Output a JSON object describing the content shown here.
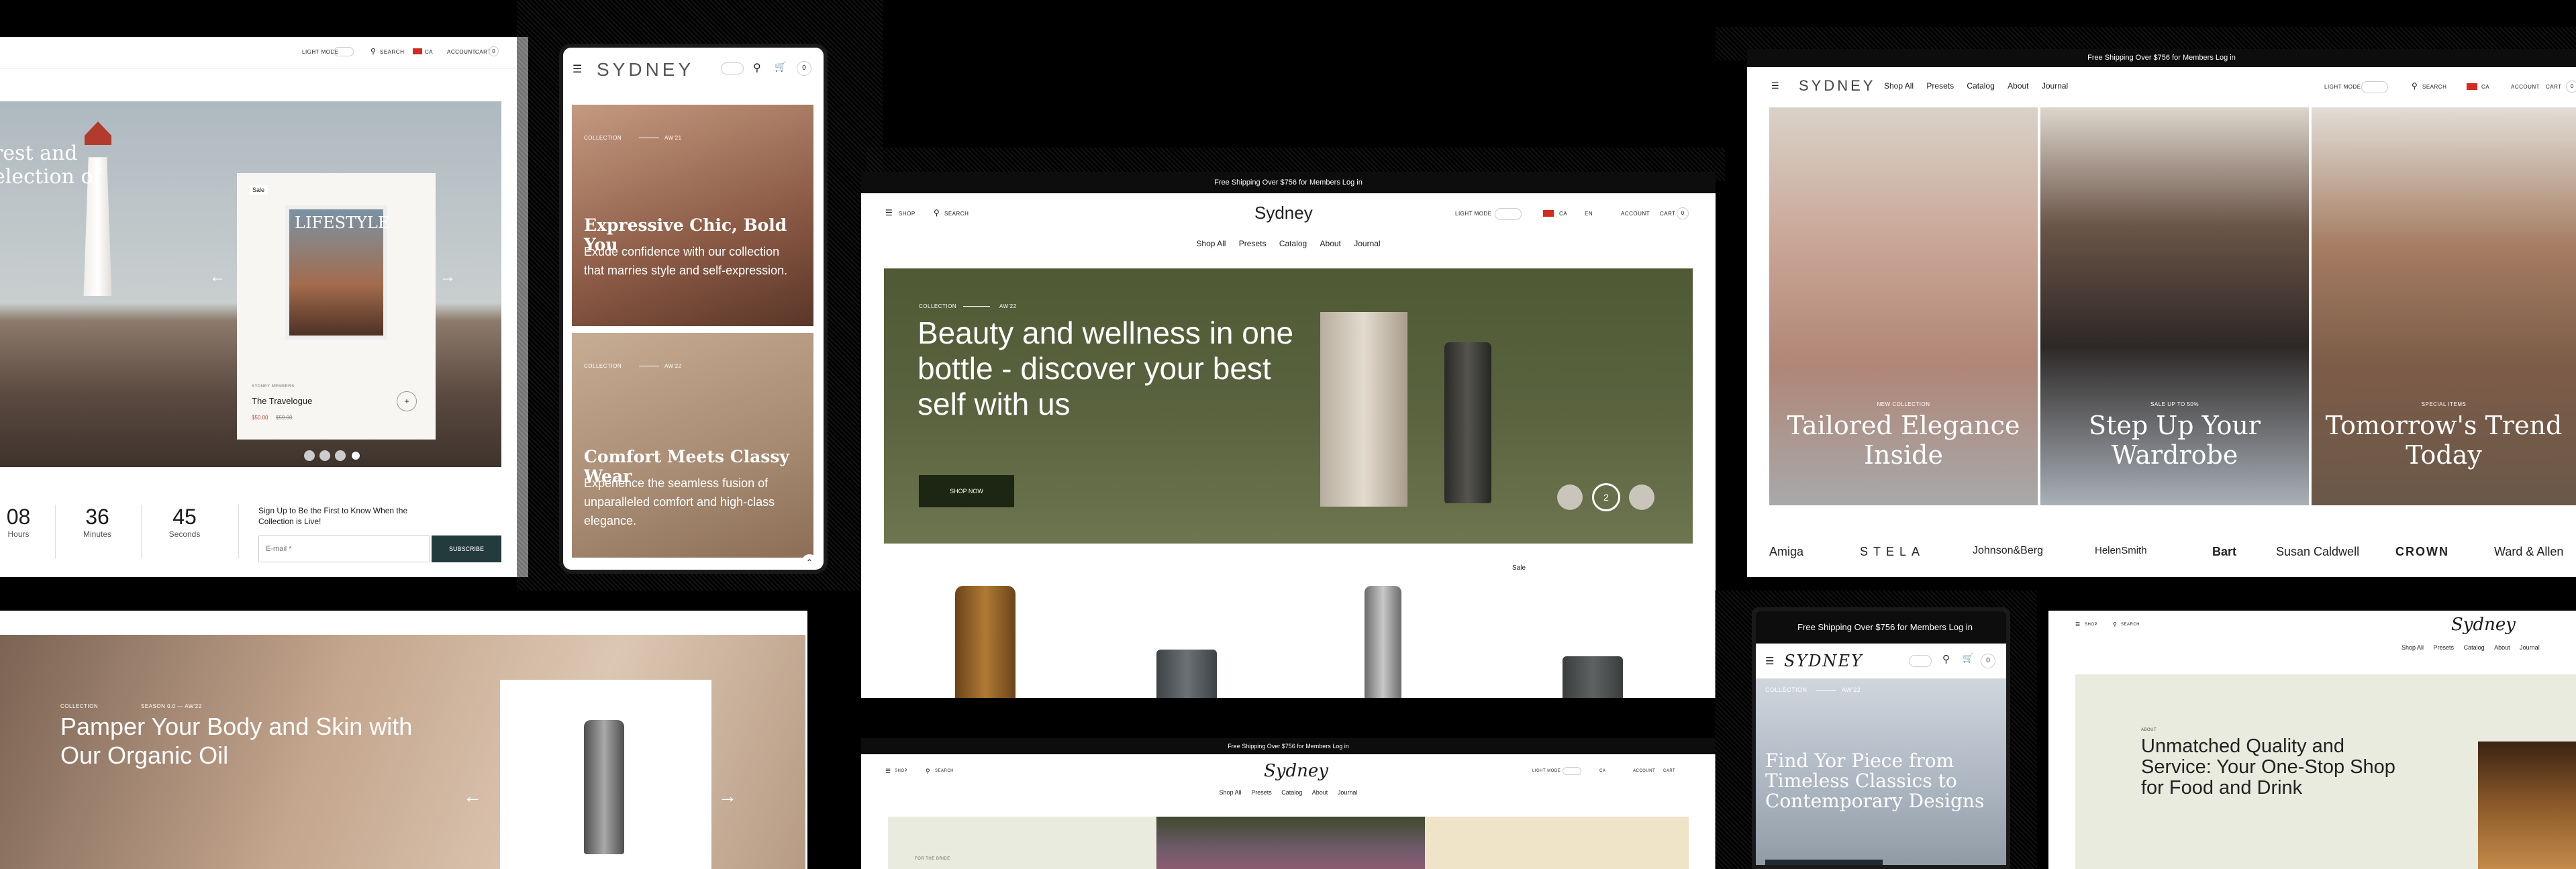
{
  "brand": "SYDNEY",
  "brand_script": "Sydney",
  "promo": {
    "text": "Free Shipping Over $756 for Members",
    "login": "Log in",
    "text_alt": "Free Shipping Over $756 for Members"
  },
  "header": {
    "shop": "SHOP",
    "search": "SEARCH",
    "light_mode": "LIGHT MODE",
    "country": "CA",
    "lang": "EN",
    "account": "ACCOUNT",
    "cart": "CART",
    "cart_count": "0"
  },
  "nav": [
    "Shop All",
    "Presets",
    "Catalog",
    "About",
    "Journal"
  ],
  "panel_a": {
    "headline_1": "rest and",
    "headline_2": "election of",
    "sale": "Sale",
    "magazine_title": "LIFESTYLE",
    "product_vendor": "SYDNEY MEMBERS",
    "product_name": "The Travelogue",
    "price_sale": "$50.00",
    "price_regular": "$59.00",
    "countdown": [
      {
        "value": "08",
        "unit": "Hours"
      },
      {
        "value": "36",
        "unit": "Minutes"
      },
      {
        "value": "45",
        "unit": "Seconds"
      }
    ],
    "newsletter_text": "Sign Up to Be the First to Know When the Collection is Live!",
    "email_placeholder": "E-mail *",
    "subscribe": "SUBSCRIBE"
  },
  "panel_b": {
    "cards": [
      {
        "collection": "COLLECTION",
        "season": "AW'21",
        "title": "Expressive Chic, Bold You",
        "text": "Exude confidence with our collection that marries style and self-expression."
      },
      {
        "collection": "COLLECTION",
        "season": "AW'22",
        "title": "Comfort Meets Classy Wear",
        "text": "Experience the seamless fusion of unparalleled comfort and high-class elegance."
      }
    ]
  },
  "panel_c": {
    "collection": "COLLECTION",
    "season": "AW'22",
    "hero_title": "Beauty and wellness in one bottle - discover your best self with us",
    "cta": "SHOP NOW",
    "slide_current": "2",
    "sale": "Sale"
  },
  "panel_d": {
    "tiles": [
      {
        "eyebrow": "NEW COLLECTION",
        "title": "Tailored Elegance Inside"
      },
      {
        "eyebrow": "SALE UP TO 50%",
        "title": "Step Up Your Wardrobe"
      },
      {
        "eyebrow": "SPECIAL ITEMS",
        "title": "Tomorrow's Trend Today"
      }
    ],
    "logos": [
      "Amiga",
      "STELA",
      "Johnson&Berg",
      "HelenSmith",
      "Bart",
      "Susan Caldwell",
      "CROWN",
      "Ward & Allen"
    ]
  },
  "panel_e": {
    "collection": "COLLECTION",
    "season": "SEASON 0.0 — AW'22",
    "title": "Pamper Your Body and Skin with Our Organic Oil"
  },
  "panel_g": {
    "collection": "COLLECTION",
    "season": "AW'22",
    "title": "Find Yor Piece from Timeless Classics to Contemporary Designs"
  },
  "panel_h": {
    "about": "ABOUT",
    "title": "Unmatched Quality and Service: Your One-Stop Shop for Food and Drink"
  },
  "panel_f": {
    "eyebrow": "FOR THE BRIDE"
  },
  "colors": {
    "accent": "#243b3e",
    "olive": "#5b6340",
    "sale": "#b8412c",
    "chic_bg": "#8b5a45",
    "comfort_bg": "#a68a72"
  }
}
